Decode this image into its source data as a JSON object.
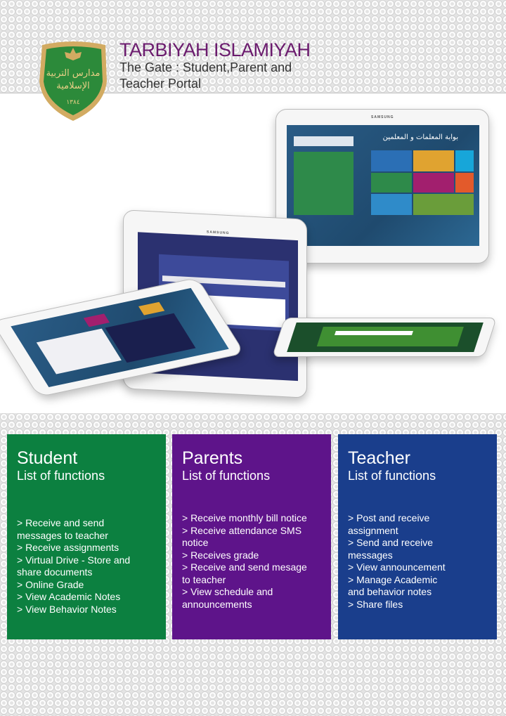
{
  "header": {
    "title": "TARBIYAH ISLAMIYAH",
    "subtitle": "The Gate : Student,Parent and Teacher Portal",
    "logo_text": "مدارس التربية الإسلامية ١٣٨٤"
  },
  "devices": {
    "brand": "SAMSUNG",
    "portal_title": "بوابة المعلمات و المعلمين"
  },
  "colors": {
    "title": "#6b1b6e",
    "student": "#0c8040",
    "parents": "#5e148a",
    "teacher": "#1a3e8c"
  },
  "cards": [
    {
      "title": "Student",
      "subtitle": "List of functions",
      "items": [
        "> Receive and send\n    messages to teacher",
        "> Receive assignments",
        "> Virtual Drive - Store   and\n   share documents",
        "> Online Grade",
        "> View Academic  Notes",
        "> View Behavior Notes"
      ]
    },
    {
      "title": "Parents",
      "subtitle": "List of functions",
      "items": [
        ">  Receive monthly bill notice",
        "> Receive attendance SMS\n   notice",
        "> Receives grade",
        "> Receive and send mesage\n  to teacher",
        "> View schedule and\n  announcements"
      ]
    },
    {
      "title": "Teacher",
      "subtitle": "List of functions",
      "items": [
        "> Post and receive\n  assignment",
        "> Send and receive\n  messages",
        "> View announcement",
        "> Manage Academic\n  and behavior notes",
        "> Share files"
      ]
    }
  ]
}
